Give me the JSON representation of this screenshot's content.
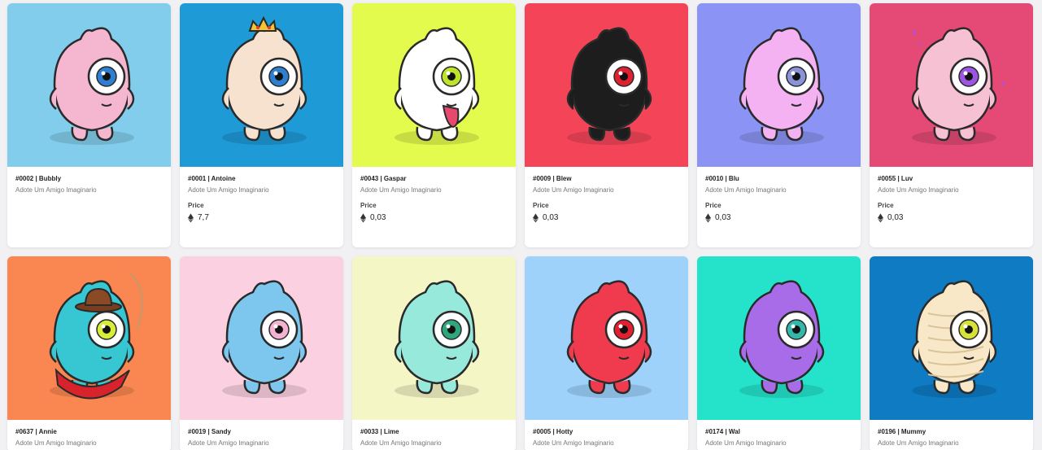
{
  "cards": [
    {
      "title": "#0002 | Bubbly",
      "subtitle": "Adote Um Amigo Imaginario",
      "price_label": "",
      "price": "",
      "bg": "#82cdec",
      "body": "#f5b6d0",
      "iris": "#2e7fd1",
      "accessory": "none"
    },
    {
      "title": "#0001 | Antoine",
      "subtitle": "Adote Um Amigo Imaginario",
      "price_label": "Price",
      "price": "7,7",
      "bg": "#1e9ad6",
      "body": "#f6e2cf",
      "iris": "#2e7fd1",
      "accessory": "crown"
    },
    {
      "title": "#0043 | Gaspar",
      "subtitle": "Adote Um Amigo Imaginario",
      "price_label": "Price",
      "price": "0,03",
      "bg": "#e3fb4c",
      "body": "#ffffff",
      "iris": "#bde32a",
      "accessory": "tongue"
    },
    {
      "title": "#0009 | Blew",
      "subtitle": "Adote Um Amigo Imaginario",
      "price_label": "Price",
      "price": "0,03",
      "bg": "#f44558",
      "body": "#1d1d1d",
      "iris": "#e02030",
      "accessory": "none"
    },
    {
      "title": "#0010 | Blu",
      "subtitle": "Adote Um Amigo Imaginario",
      "price_label": "Price",
      "price": "0,03",
      "bg": "#8b93f4",
      "body": "#f4b2f2",
      "iris": "#8a93d8",
      "accessory": "none"
    },
    {
      "title": "#0055 | Luv",
      "subtitle": "Adote Um Amigo Imaginario",
      "price_label": "Price",
      "price": "0,03",
      "bg": "#e44a75",
      "body": "#f7c1d4",
      "iris": "#9b55e0",
      "accessory": "hearts"
    },
    {
      "title": "#0637 | Annie",
      "subtitle": "Adote Um Amigo Imaginario",
      "price_label": "",
      "price": "",
      "bg": "#fa8751",
      "body": "#36c7d3",
      "iris": "#d8ec3a",
      "accessory": "cowboy"
    },
    {
      "title": "#0019 | Sandy",
      "subtitle": "Adote Um Amigo Imaginario",
      "price_label": "",
      "price": "",
      "bg": "#fbd1e1",
      "body": "#7dc7ef",
      "iris": "#f3b2cf",
      "accessory": "none"
    },
    {
      "title": "#0033 | Lime",
      "subtitle": "Adote Um Amigo Imaginario",
      "price_label": "",
      "price": "",
      "bg": "#f5f6c6",
      "body": "#97eadb",
      "iris": "#2fa77c",
      "accessory": "none"
    },
    {
      "title": "#0005 | Hotty",
      "subtitle": "Adote Um Amigo Imaginario",
      "price_label": "",
      "price": "",
      "bg": "#9fd2fb",
      "body": "#ef3b4d",
      "iris": "#e02030",
      "accessory": "none"
    },
    {
      "title": "#0174 | Wal",
      "subtitle": "Adote Um Amigo Imaginario",
      "price_label": "",
      "price": "",
      "bg": "#25e3cb",
      "body": "#a96ce8",
      "iris": "#33b7a8",
      "accessory": "none"
    },
    {
      "title": "#0196 | Mummy",
      "subtitle": "Adote Um Amigo Imaginario",
      "price_label": "",
      "price": "",
      "bg": "#0f7bc3",
      "body": "#f9e8c7",
      "iris": "#d6e23a",
      "accessory": "mummy"
    }
  ]
}
